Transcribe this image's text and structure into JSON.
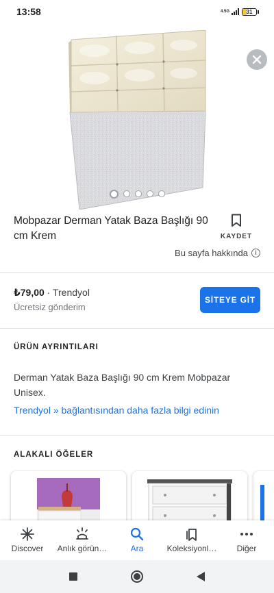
{
  "status_bar": {
    "time": "13:58",
    "network": "4.5G",
    "battery": "31",
    "battery_level": 0.31
  },
  "colors": {
    "accent": "#1a73e8",
    "headboard_cushion": "#ece6cf",
    "base_fabric": "#dcdcdf"
  },
  "gallery": {
    "image_count": 5,
    "active_index": 0,
    "close_icon": "close-icon"
  },
  "product": {
    "title": "Mobpazar Derman Yatak Baza Başlığı 90 cm Krem",
    "save_label": "KAYDET",
    "about_label": "Bu sayfa hakkında"
  },
  "offer": {
    "price": "₺79,00",
    "separator": " · ",
    "seller": "Trendyol",
    "shipping": "Ücretsiz gönderim",
    "button_label": "SİTEYE GİT"
  },
  "details": {
    "heading": "ÜRÜN AYRINTILARI",
    "description": "Derman Yatak Baza Başlığı 90 cm Krem Mobpazar Unisex.",
    "link": "Trendyol » bağlantısından daha fazla bilgi edinin"
  },
  "related": {
    "heading": "ALAKALI ÖĞELER"
  },
  "bottom_nav": {
    "items": [
      {
        "label": "Discover",
        "icon": "asterisk-icon"
      },
      {
        "label": "Anlık görün…",
        "icon": "updates-icon"
      },
      {
        "label": "Ara",
        "icon": "search-icon"
      },
      {
        "label": "Koleksiyonl…",
        "icon": "collections-icon"
      },
      {
        "label": "Diğer",
        "icon": "more-icon"
      }
    ],
    "active": "Ara"
  }
}
